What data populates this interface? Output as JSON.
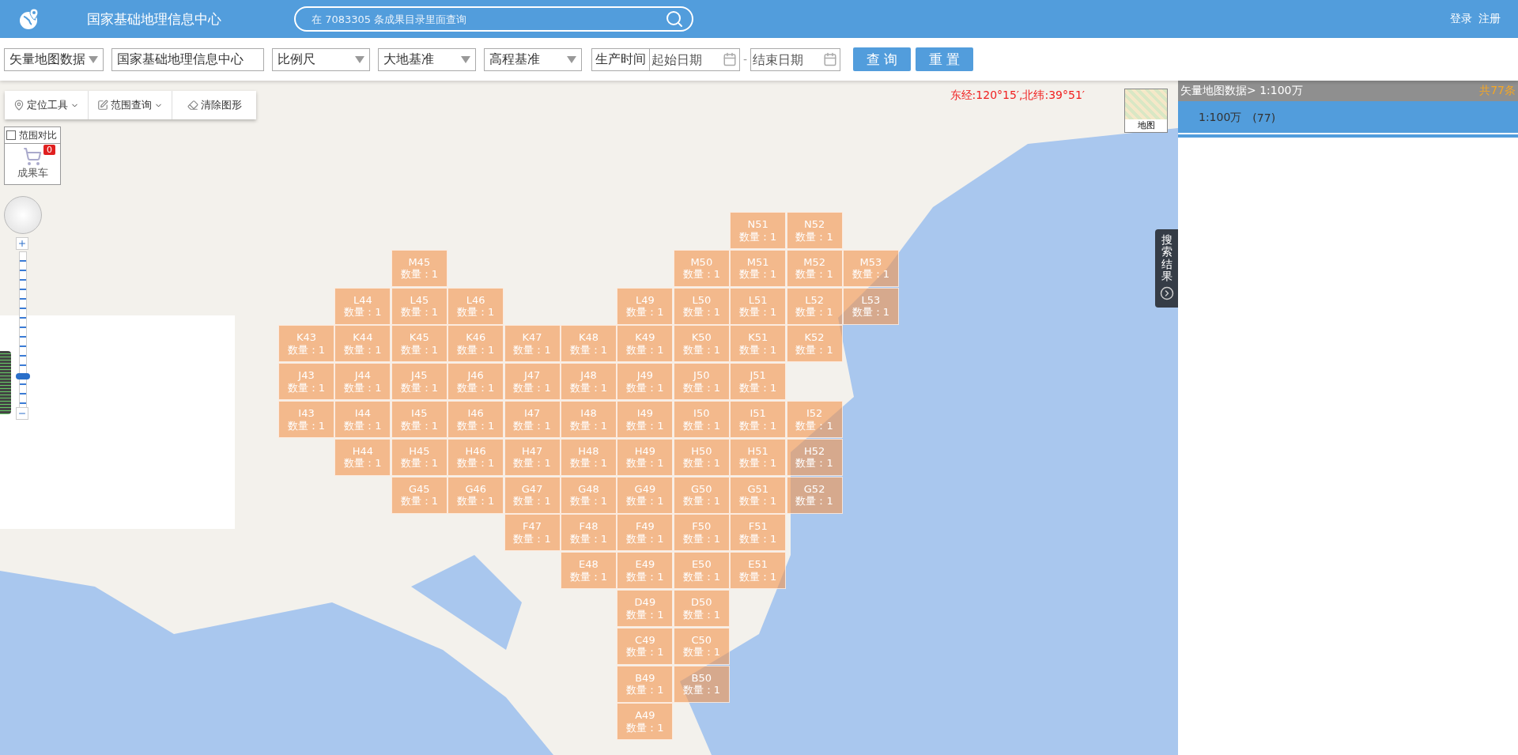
{
  "header": {
    "title": "国家基础地理信息中心",
    "search": {
      "placeholder": "在 7083305 条成果目录里面查询"
    },
    "links": [
      "登录",
      "注册"
    ]
  },
  "filters": {
    "fields": [
      {
        "kind": "select",
        "value": "矢量地图数据"
      },
      {
        "kind": "text",
        "value": "国家基础地理信息中心"
      },
      {
        "kind": "select",
        "value": "比例尺"
      },
      {
        "kind": "select",
        "value": "大地基准"
      },
      {
        "kind": "select",
        "value": "高程基准"
      }
    ],
    "production_time": {
      "label": "生产时间",
      "start": {
        "placeholder": "起始日期"
      },
      "separator": "-",
      "end": {
        "placeholder": "结束日期"
      }
    },
    "buttons": [
      "查 询",
      "重 置"
    ]
  },
  "map": {
    "tools": [
      {
        "label": "定位工具",
        "kind": "dropdown"
      },
      {
        "label": "范围查询",
        "kind": "dropdown"
      },
      {
        "label": "清除图形",
        "kind": "action"
      }
    ],
    "compare": {
      "label": "范围对比",
      "checked": false
    },
    "cart": {
      "label": "成果车",
      "badge": "0"
    },
    "zoom_slider": {
      "level": 0.2
    },
    "coordinates": "东经:120°15′,北纬:39°51′",
    "layer_switch": {
      "label": "地图"
    },
    "results_tab": {
      "label": "搜索结果"
    },
    "grid": {
      "rows": [
        [
          {
            "kind": "gap"
          },
          {
            "kind": "gap"
          },
          {
            "kind": "gap"
          },
          {
            "kind": "gap"
          },
          {
            "kind": "gap"
          },
          {
            "kind": "gap"
          },
          {
            "kind": "gap"
          },
          {
            "kind": "gap"
          },
          {
            "kind": "sheet",
            "sheet": "N51",
            "count": "数量：1"
          },
          {
            "kind": "sheet",
            "sheet": "N52",
            "count": "数量：1"
          },
          {
            "kind": "gap"
          }
        ],
        [
          {
            "kind": "gap"
          },
          {
            "kind": "gap"
          },
          {
            "kind": "sheet",
            "sheet": "M45",
            "count": "数量：1"
          },
          {
            "kind": "gap"
          },
          {
            "kind": "gap"
          },
          {
            "kind": "gap"
          },
          {
            "kind": "gap"
          },
          {
            "kind": "sheet",
            "sheet": "M50",
            "count": "数量：1"
          },
          {
            "kind": "sheet",
            "sheet": "M51",
            "count": "数量：1"
          },
          {
            "kind": "sheet",
            "sheet": "M52",
            "count": "数量：1"
          },
          {
            "kind": "sheet",
            "sheet": "M53",
            "count": "数量：1"
          }
        ],
        [
          {
            "kind": "gap"
          },
          {
            "kind": "sheet",
            "sheet": "L44",
            "count": "数量：1"
          },
          {
            "kind": "sheet",
            "sheet": "L45",
            "count": "数量：1"
          },
          {
            "kind": "sheet",
            "sheet": "L46",
            "count": "数量：1"
          },
          {
            "kind": "gap"
          },
          {
            "kind": "gap"
          },
          {
            "kind": "sheet",
            "sheet": "L49",
            "count": "数量：1"
          },
          {
            "kind": "sheet",
            "sheet": "L50",
            "count": "数量：1"
          },
          {
            "kind": "sheet",
            "sheet": "L51",
            "count": "数量：1"
          },
          {
            "kind": "sheet",
            "sheet": "L52",
            "count": "数量：1"
          },
          {
            "kind": "sheet",
            "sheet": "L53",
            "count": "数量：1"
          }
        ],
        [
          {
            "kind": "sheet",
            "sheet": "K43",
            "count": "数量：1"
          },
          {
            "kind": "sheet",
            "sheet": "K44",
            "count": "数量：1"
          },
          {
            "kind": "sheet",
            "sheet": "K45",
            "count": "数量：1"
          },
          {
            "kind": "sheet",
            "sheet": "K46",
            "count": "数量：1"
          },
          {
            "kind": "sheet",
            "sheet": "K47",
            "count": "数量：1"
          },
          {
            "kind": "sheet",
            "sheet": "K48",
            "count": "数量：1"
          },
          {
            "kind": "sheet",
            "sheet": "K49",
            "count": "数量：1"
          },
          {
            "kind": "sheet",
            "sheet": "K50",
            "count": "数量：1"
          },
          {
            "kind": "sheet",
            "sheet": "K51",
            "count": "数量：1"
          },
          {
            "kind": "sheet",
            "sheet": "K52",
            "count": "数量：1"
          },
          {
            "kind": "gap"
          }
        ],
        [
          {
            "kind": "sheet",
            "sheet": "J43",
            "count": "数量：1"
          },
          {
            "kind": "sheet",
            "sheet": "J44",
            "count": "数量：1"
          },
          {
            "kind": "sheet",
            "sheet": "J45",
            "count": "数量：1"
          },
          {
            "kind": "sheet",
            "sheet": "J46",
            "count": "数量：1"
          },
          {
            "kind": "sheet",
            "sheet": "J47",
            "count": "数量：1"
          },
          {
            "kind": "sheet",
            "sheet": "J48",
            "count": "数量：1"
          },
          {
            "kind": "sheet",
            "sheet": "J49",
            "count": "数量：1"
          },
          {
            "kind": "sheet",
            "sheet": "J50",
            "count": "数量：1"
          },
          {
            "kind": "sheet",
            "sheet": "J51",
            "count": "数量：1"
          },
          {
            "kind": "gap"
          },
          {
            "kind": "gap"
          }
        ],
        [
          {
            "kind": "sheet",
            "sheet": "I43",
            "count": "数量：1"
          },
          {
            "kind": "sheet",
            "sheet": "I44",
            "count": "数量：1"
          },
          {
            "kind": "sheet",
            "sheet": "I45",
            "count": "数量：1"
          },
          {
            "kind": "sheet",
            "sheet": "I46",
            "count": "数量：1"
          },
          {
            "kind": "sheet",
            "sheet": "I47",
            "count": "数量：1"
          },
          {
            "kind": "sheet",
            "sheet": "I48",
            "count": "数量：1"
          },
          {
            "kind": "sheet",
            "sheet": "I49",
            "count": "数量：1"
          },
          {
            "kind": "sheet",
            "sheet": "I50",
            "count": "数量：1"
          },
          {
            "kind": "sheet",
            "sheet": "I51",
            "count": "数量：1"
          },
          {
            "kind": "sheet",
            "sheet": "I52",
            "count": "数量：1"
          },
          {
            "kind": "gap"
          }
        ],
        [
          {
            "kind": "gap"
          },
          {
            "kind": "sheet",
            "sheet": "H44",
            "count": "数量：1"
          },
          {
            "kind": "sheet",
            "sheet": "H45",
            "count": "数量：1"
          },
          {
            "kind": "sheet",
            "sheet": "H46",
            "count": "数量：1"
          },
          {
            "kind": "sheet",
            "sheet": "H47",
            "count": "数量：1"
          },
          {
            "kind": "sheet",
            "sheet": "H48",
            "count": "数量：1"
          },
          {
            "kind": "sheet",
            "sheet": "H49",
            "count": "数量：1"
          },
          {
            "kind": "sheet",
            "sheet": "H50",
            "count": "数量：1"
          },
          {
            "kind": "sheet",
            "sheet": "H51",
            "count": "数量：1"
          },
          {
            "kind": "sheet",
            "sheet": "H52",
            "count": "数量：1"
          },
          {
            "kind": "gap"
          }
        ],
        [
          {
            "kind": "gap"
          },
          {
            "kind": "gap"
          },
          {
            "kind": "sheet",
            "sheet": "G45",
            "count": "数量：1"
          },
          {
            "kind": "sheet",
            "sheet": "G46",
            "count": "数量：1"
          },
          {
            "kind": "sheet",
            "sheet": "G47",
            "count": "数量：1"
          },
          {
            "kind": "sheet",
            "sheet": "G48",
            "count": "数量：1"
          },
          {
            "kind": "sheet",
            "sheet": "G49",
            "count": "数量：1"
          },
          {
            "kind": "sheet",
            "sheet": "G50",
            "count": "数量：1"
          },
          {
            "kind": "sheet",
            "sheet": "G51",
            "count": "数量：1"
          },
          {
            "kind": "sheet",
            "sheet": "G52",
            "count": "数量：1"
          },
          {
            "kind": "gap"
          }
        ],
        [
          {
            "kind": "gap"
          },
          {
            "kind": "gap"
          },
          {
            "kind": "gap"
          },
          {
            "kind": "gap"
          },
          {
            "kind": "sheet",
            "sheet": "F47",
            "count": "数量：1"
          },
          {
            "kind": "sheet",
            "sheet": "F48",
            "count": "数量：1"
          },
          {
            "kind": "sheet",
            "sheet": "F49",
            "count": "数量：1"
          },
          {
            "kind": "sheet",
            "sheet": "F50",
            "count": "数量：1"
          },
          {
            "kind": "sheet",
            "sheet": "F51",
            "count": "数量：1"
          },
          {
            "kind": "gap"
          },
          {
            "kind": "gap"
          }
        ],
        [
          {
            "kind": "gap"
          },
          {
            "kind": "gap"
          },
          {
            "kind": "gap"
          },
          {
            "kind": "gap"
          },
          {
            "kind": "gap"
          },
          {
            "kind": "sheet",
            "sheet": "E48",
            "count": "数量：1"
          },
          {
            "kind": "sheet",
            "sheet": "E49",
            "count": "数量：1"
          },
          {
            "kind": "sheet",
            "sheet": "E50",
            "count": "数量：1"
          },
          {
            "kind": "sheet",
            "sheet": "E51",
            "count": "数量：1"
          },
          {
            "kind": "gap"
          },
          {
            "kind": "gap"
          }
        ],
        [
          {
            "kind": "gap"
          },
          {
            "kind": "gap"
          },
          {
            "kind": "gap"
          },
          {
            "kind": "gap"
          },
          {
            "kind": "gap"
          },
          {
            "kind": "gap"
          },
          {
            "kind": "sheet",
            "sheet": "D49",
            "count": "数量：1"
          },
          {
            "kind": "sheet",
            "sheet": "D50",
            "count": "数量：1"
          },
          {
            "kind": "gap"
          },
          {
            "kind": "gap"
          },
          {
            "kind": "gap"
          }
        ],
        [
          {
            "kind": "gap"
          },
          {
            "kind": "gap"
          },
          {
            "kind": "gap"
          },
          {
            "kind": "gap"
          },
          {
            "kind": "gap"
          },
          {
            "kind": "gap"
          },
          {
            "kind": "sheet",
            "sheet": "C49",
            "count": "数量：1"
          },
          {
            "kind": "sheet",
            "sheet": "C50",
            "count": "数量：1"
          },
          {
            "kind": "gap"
          },
          {
            "kind": "gap"
          },
          {
            "kind": "gap"
          }
        ],
        [
          {
            "kind": "gap"
          },
          {
            "kind": "gap"
          },
          {
            "kind": "gap"
          },
          {
            "kind": "gap"
          },
          {
            "kind": "gap"
          },
          {
            "kind": "gap"
          },
          {
            "kind": "sheet",
            "sheet": "B49",
            "count": "数量：1"
          },
          {
            "kind": "sheet",
            "sheet": "B50",
            "count": "数量：1"
          },
          {
            "kind": "gap"
          },
          {
            "kind": "gap"
          },
          {
            "kind": "gap"
          }
        ],
        [
          {
            "kind": "gap"
          },
          {
            "kind": "gap"
          },
          {
            "kind": "gap"
          },
          {
            "kind": "gap"
          },
          {
            "kind": "gap"
          },
          {
            "kind": "gap"
          },
          {
            "kind": "sheet",
            "sheet": "A49",
            "count": "数量：1"
          },
          {
            "kind": "gap"
          },
          {
            "kind": "gap"
          },
          {
            "kind": "gap"
          },
          {
            "kind": "gap"
          }
        ]
      ]
    }
  },
  "results": {
    "breadcrumb": "矢量地图数据> 1:100万",
    "total": "共77条",
    "items": [
      {
        "label": "1:100万",
        "count": "(77)",
        "selected": true
      }
    ]
  }
}
